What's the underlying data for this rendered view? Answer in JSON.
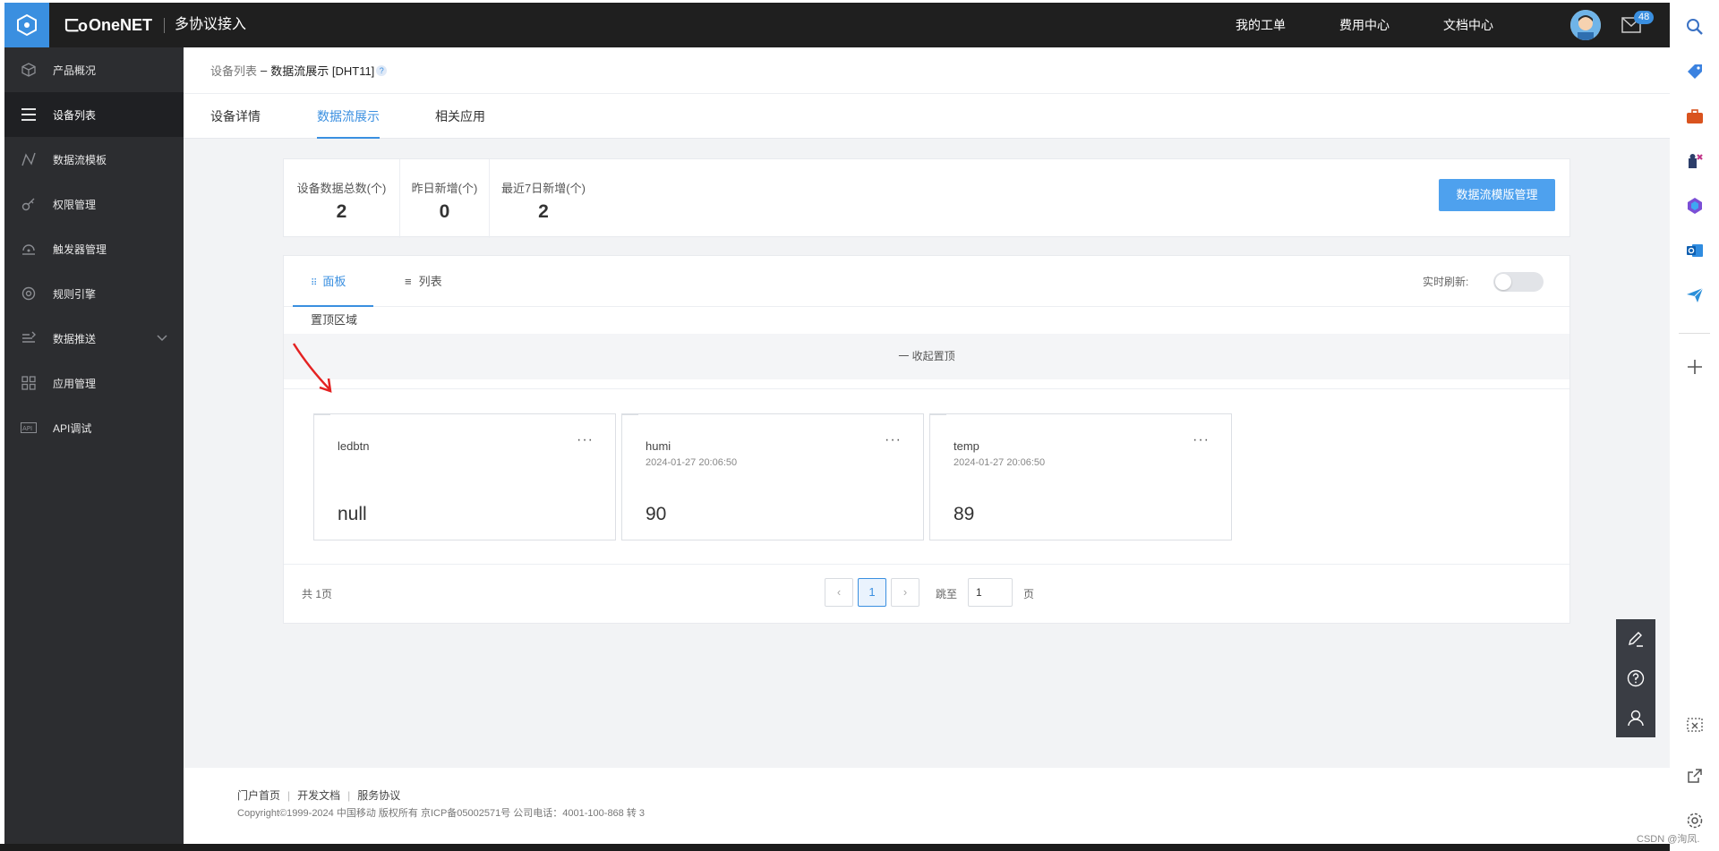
{
  "topbar": {
    "brand": "OneNET",
    "product": "多协议接入",
    "nav": [
      "我的工单",
      "费用中心",
      "文档中心"
    ],
    "mail_badge": "48"
  },
  "sidebar": {
    "items": [
      {
        "label": "产品概况",
        "icon": "cube-icon"
      },
      {
        "label": "设备列表",
        "icon": "list-icon"
      },
      {
        "label": "数据流模板",
        "icon": "stream-icon"
      },
      {
        "label": "权限管理",
        "icon": "key-icon"
      },
      {
        "label": "触发器管理",
        "icon": "trigger-icon"
      },
      {
        "label": "规则引擎",
        "icon": "engine-icon"
      },
      {
        "label": "数据推送",
        "icon": "push-icon"
      },
      {
        "label": "应用管理",
        "icon": "grid-icon"
      },
      {
        "label": "API调试",
        "icon": "api-icon"
      }
    ],
    "active_index": 1
  },
  "breadcrumb": {
    "root": "设备列表",
    "separator": "–",
    "current": "数据流展示 [DHT11]",
    "help": "?"
  },
  "tabs": [
    "设备详情",
    "数据流展示",
    "相关应用"
  ],
  "active_tab": 1,
  "stats": [
    {
      "label": "设备数据总数(个)",
      "value": "2"
    },
    {
      "label": "昨日新增(个)",
      "value": "0"
    },
    {
      "label": "最近7日新增(个)",
      "value": "2"
    }
  ],
  "template_button": "数据流模版管理",
  "view_tabs": [
    {
      "label": "面板",
      "icon": "grid-small-icon"
    },
    {
      "label": "列表",
      "icon": "list-lines-icon"
    }
  ],
  "realtime_label": "实时刷新:",
  "realtime_on": false,
  "pin_area": "置顶区域",
  "collapse_pin": "一 收起置顶",
  "datastreams": [
    {
      "name": "ledbtn",
      "time": "",
      "value": "null"
    },
    {
      "name": "humi",
      "time": "2024-01-27 20:06:50",
      "value": "90"
    },
    {
      "name": "temp",
      "time": "2024-01-27 20:06:50",
      "value": "89"
    }
  ],
  "pagination": {
    "total": "共 1页",
    "prev": "‹",
    "current": "1",
    "next": "›",
    "jump_label": "跳至",
    "jump_value": "1",
    "page_suffix": "页"
  },
  "footer": {
    "links": [
      "门户首页",
      "开发文档",
      "服务协议"
    ],
    "copyright": "Copyright©1999-2024 中国移动 版权所有 京ICP备05002571号 公司电话：4001-100-868 转 3"
  },
  "watermark": "CSDN @洵凤."
}
